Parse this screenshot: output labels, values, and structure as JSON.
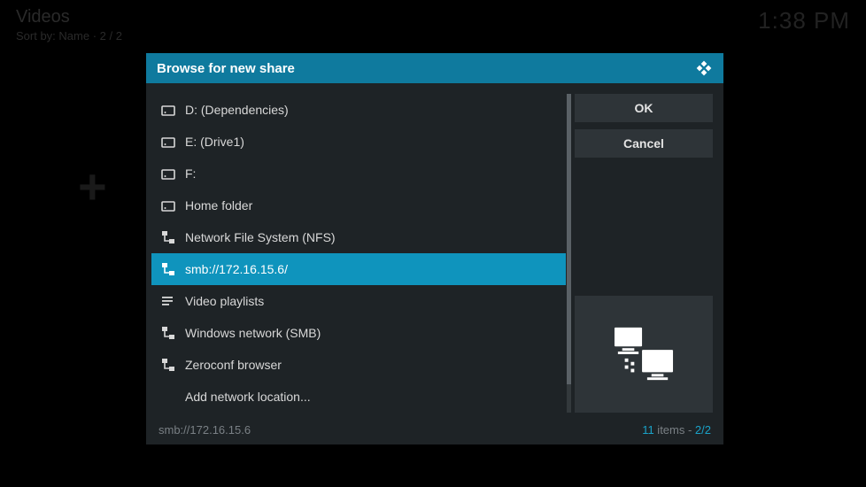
{
  "background": {
    "title": "Videos",
    "sort_line": "Sort by: Name  ·  2 / 2",
    "clock": "1:38 PM"
  },
  "dialog": {
    "title": "Browse for new share",
    "ok_label": "OK",
    "cancel_label": "Cancel",
    "footer_path": "smb://172.16.15.6",
    "footer_count_num": "11",
    "footer_count_word": " items - ",
    "footer_page": "2/2"
  },
  "items": [
    {
      "icon": "drive",
      "label": "D: (Dependencies)",
      "selected": false
    },
    {
      "icon": "drive",
      "label": "E: (Drive1)",
      "selected": false
    },
    {
      "icon": "drive",
      "label": "F:",
      "selected": false
    },
    {
      "icon": "drive",
      "label": "Home folder",
      "selected": false
    },
    {
      "icon": "network",
      "label": "Network File System (NFS)",
      "selected": false
    },
    {
      "icon": "network",
      "label": "smb://172.16.15.6/",
      "selected": true
    },
    {
      "icon": "playlist",
      "label": "Video playlists",
      "selected": false
    },
    {
      "icon": "network",
      "label": "Windows network (SMB)",
      "selected": false
    },
    {
      "icon": "network",
      "label": "Zeroconf browser",
      "selected": false
    },
    {
      "icon": "none",
      "label": "Add network location...",
      "selected": false
    }
  ]
}
